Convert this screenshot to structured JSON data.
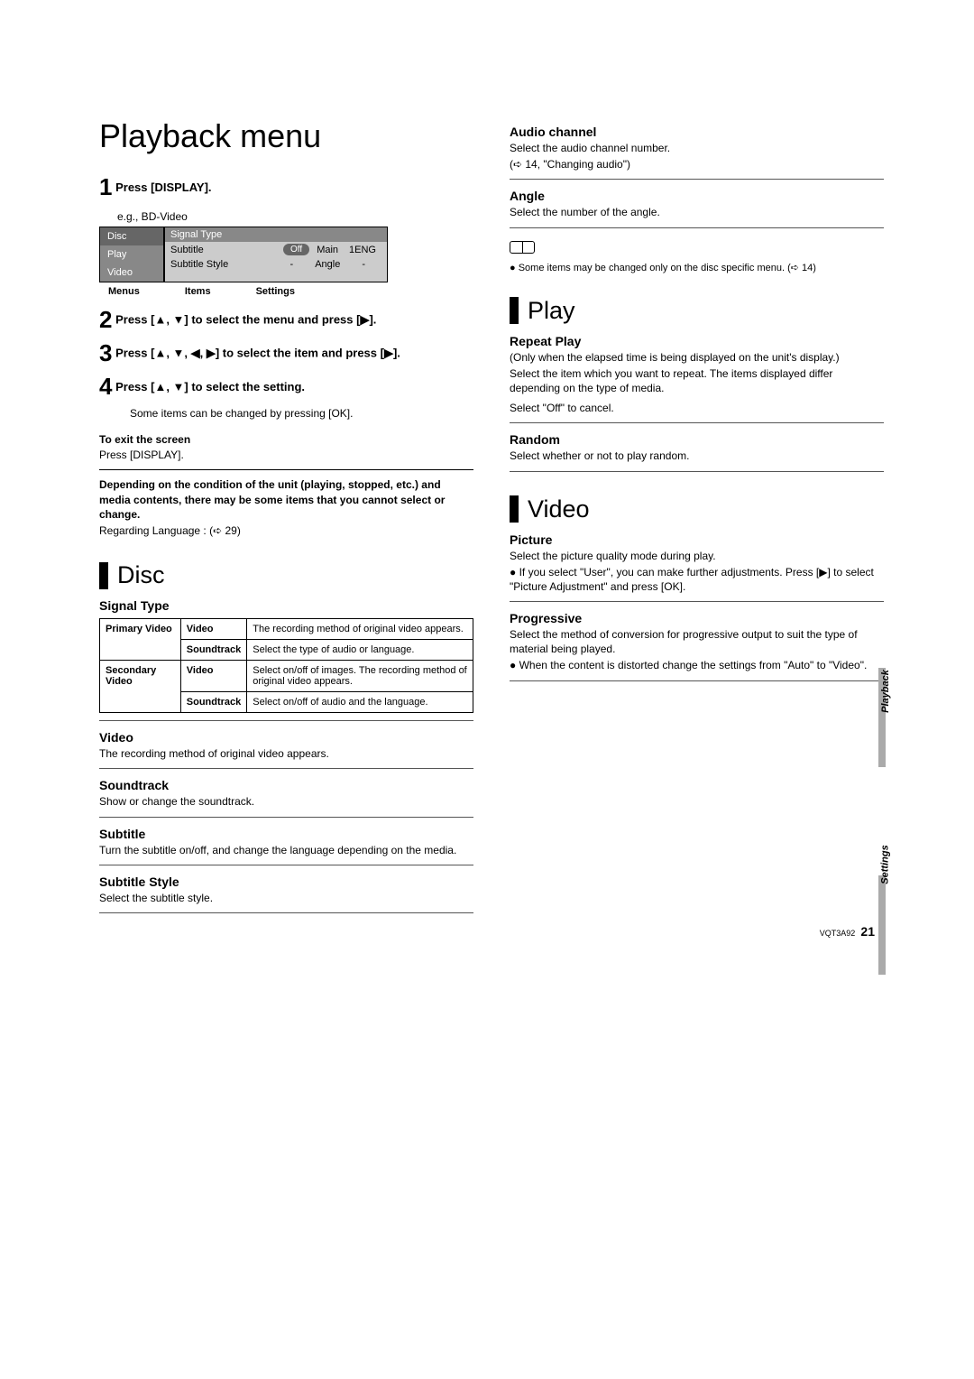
{
  "doc_id": "VQT3A92",
  "page_number": "21",
  "title": "Playback menu",
  "step1": "Press [DISPLAY].",
  "eg": "e.g., BD-Video",
  "menu": {
    "left": [
      "Disc",
      "Play",
      "Video"
    ],
    "r1": "Signal Type",
    "r2": {
      "l": "Subtitle",
      "off": "Off",
      "main": "Main",
      "eng": "1ENG"
    },
    "r3": {
      "l": "Subtitle Style",
      "d1": "-",
      "angle": "Angle",
      "d2": "-"
    }
  },
  "legend": {
    "a": "Menus",
    "b": "Items",
    "c": "Settings"
  },
  "step2": "Press [▲, ▼] to select the menu and press [▶].",
  "step3": "Press [▲, ▼, ◀, ▶] to select the item and press [▶].",
  "step4": "Press [▲, ▼] to select the setting.",
  "step4_note": "Some items can be changed by pressing [OK].",
  "exit_h": "To exit the screen",
  "exit_b": "Press [DISPLAY].",
  "cond": "Depending on the condition of the unit (playing, stopped, etc.) and media contents, there may be some items that you cannot select or change.",
  "lang": "Regarding Language : (➪ 29)",
  "disc": {
    "title": "Disc",
    "signal": "Signal Type",
    "tbl": {
      "r1a": "Primary Video",
      "r1b": "Video",
      "r1c": "The recording method of original video appears.",
      "r2b": "Soundtrack",
      "r2c": "Select the type of audio or language.",
      "r3a": "Secondary Video",
      "r3b": "Video",
      "r3c": "Select on/off of images. The recording method of original video appears.",
      "r4b": "Soundtrack",
      "r4c": "Select on/off of audio and the language."
    },
    "video_h": "Video",
    "video_b": "The recording method of original video appears.",
    "st_h": "Soundtrack",
    "st_b": "Show or change the soundtrack.",
    "sub_h": "Subtitle",
    "sub_b": "Turn the subtitle on/off, and change the language depending on the media.",
    "ss_h": "Subtitle Style",
    "ss_b": "Select the subtitle style."
  },
  "right": {
    "audio_h": "Audio channel",
    "audio_b1": "Select the audio channel number.",
    "audio_b2": "(➪ 14, \"Changing audio\")",
    "angle_h": "Angle",
    "angle_b": "Select the number of the angle.",
    "note": "Some items may be changed only on the disc specific menu. (➪ 14)"
  },
  "play": {
    "title": "Play",
    "rp_h": "Repeat Play",
    "rp_b1": "(Only when the elapsed time is being displayed on the unit's display.)",
    "rp_b2": "Select the item which you want to repeat. The items displayed differ depending on the type of media.",
    "rp_b3": "Select \"Off\" to cancel.",
    "rnd_h": "Random",
    "rnd_b": "Select whether or not to play random."
  },
  "video": {
    "title": "Video",
    "pic_h": "Picture",
    "pic_b1": "Select the picture quality mode during play.",
    "pic_b2": "If you select \"User\", you can make further adjustments. Press [▶] to select \"Picture Adjustment\" and press [OK].",
    "prog_h": "Progressive",
    "prog_b1": "Select the method of conversion for progressive output to suit the type of material being played.",
    "prog_b2": "When the content is distorted change the settings from \"Auto\" to \"Video\"."
  },
  "tabs": {
    "a": "Playback",
    "b": "Settings"
  }
}
